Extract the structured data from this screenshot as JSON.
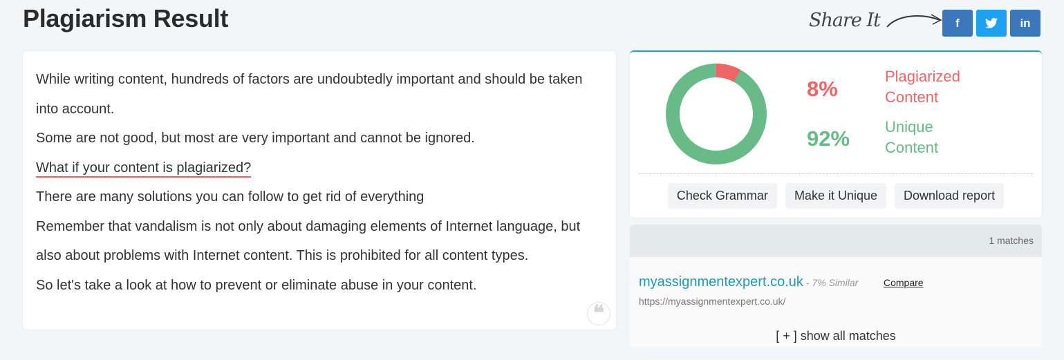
{
  "page": {
    "title": "Plagiarism Result"
  },
  "share": {
    "label": "Share It",
    "buttons": [
      {
        "name": "facebook",
        "glyph": "f",
        "color": "#3b78bb"
      },
      {
        "name": "twitter",
        "glyph": "🐦",
        "color": "#1da1f2"
      },
      {
        "name": "linkedin",
        "glyph": "in",
        "color": "#3b78bb"
      }
    ]
  },
  "content": {
    "paragraphs": [
      "While writing content, hundreds of factors are undoubtedly important and should be taken into account.",
      "Some are not good, but most are very important and cannot be ignored.",
      "What if your content is plagiarized?",
      "There are many solutions you can follow to get rid of everything",
      "Remember that vandalism is not only about damaging elements of Internet language, but also about problems with Internet content. This is prohibited for all content types.",
      "So let's take a look at how to prevent or eliminate abuse in your content."
    ],
    "highlighted_index": 2,
    "quote_glyph": "❝"
  },
  "stats": {
    "plagiarized": {
      "percent": 8,
      "display": "8%",
      "label": "Plagiarized Content",
      "color": "#ef6565"
    },
    "unique": {
      "percent": 92,
      "display": "92%",
      "label": "Unique Content",
      "color": "#68bb87"
    },
    "actions": [
      "Check Grammar",
      "Make it Unique",
      "Download report"
    ]
  },
  "matches": {
    "count_label": "1 matches",
    "items": [
      {
        "domain": "myassignmentexpert.co.uk",
        "similarity": "- 7% Similar",
        "compare_label": "Compare",
        "url": "https://myassignmentexpert.co.uk/"
      }
    ],
    "show_all_label": "[ + ] show all matches"
  }
}
